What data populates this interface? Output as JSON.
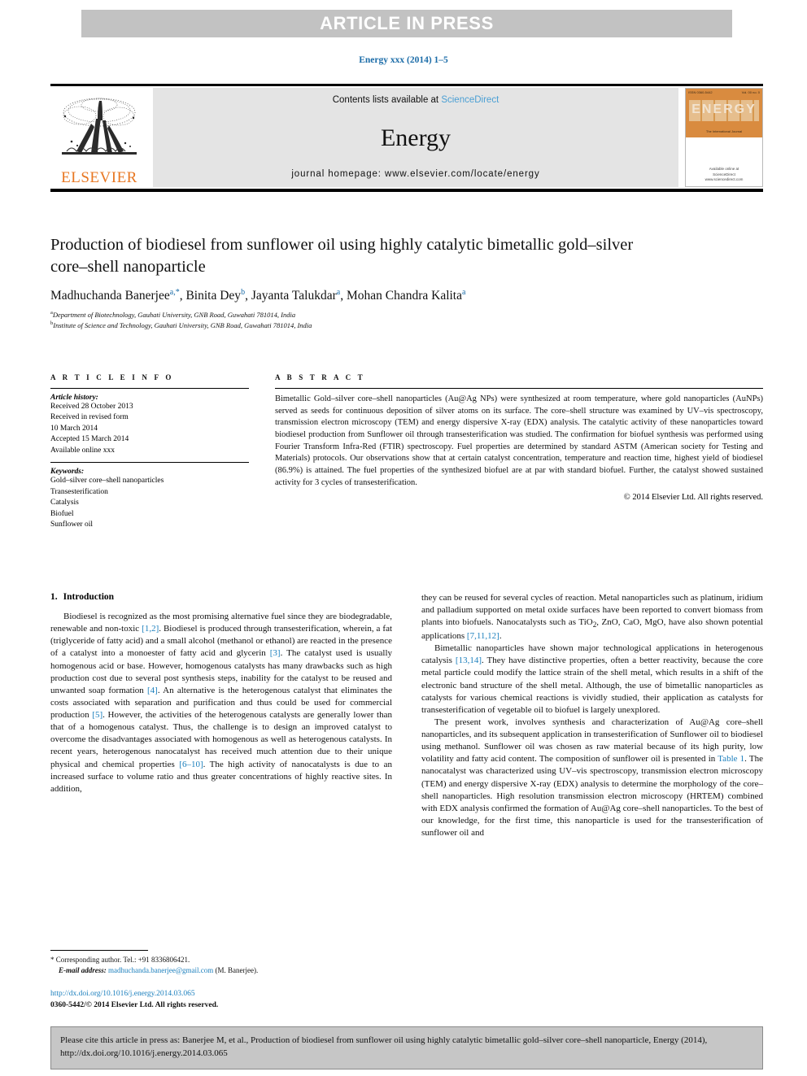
{
  "banner": {
    "label": "ARTICLE IN PRESS"
  },
  "running_head": "Energy xxx (2014) 1–5",
  "masthead": {
    "contents_prefix": "Contents lists available at ",
    "sciencedirect": "ScienceDirect",
    "journal_name": "Energy",
    "homepage": "journal homepage: www.elsevier.com/locate/energy",
    "publisher": "ELSEVIER",
    "cover": {
      "header_left": "ISSN 0360-5442",
      "header_right": "Vol. 00 no. 0",
      "word": "ENERGY",
      "subtitle": "The International Journal",
      "footer": "Available online at\nScienceDirect\nwww.sciencedirect.com"
    }
  },
  "article": {
    "title": "Production of biodiesel from sunflower oil using highly catalytic bimetallic gold–silver core–shell nanoparticle",
    "authors": [
      {
        "name": "Madhuchanda Banerjee",
        "marks": "a,*"
      },
      {
        "name": "Binita Dey",
        "marks": "b"
      },
      {
        "name": "Jayanta Talukdar",
        "marks": "a"
      },
      {
        "name": "Mohan Chandra Kalita",
        "marks": "a"
      }
    ],
    "affiliations": [
      {
        "mark": "a",
        "text": "Department of Biotechnology, Gauhati University, GNB Road, Guwahati 781014, India"
      },
      {
        "mark": "b",
        "text": "Institute of Science and Technology, Gauhati University, GNB Road, Guwahati 781014, India"
      }
    ]
  },
  "article_info": {
    "heading": "A R T I C L E  I N F O",
    "history_label": "Article history:",
    "history": [
      "Received 28 October 2013",
      "Received in revised form",
      "10 March 2014",
      "Accepted 15 March 2014",
      "Available online xxx"
    ],
    "keywords_label": "Keywords:",
    "keywords": [
      "Gold–silver core–shell nanoparticles",
      "Transesterification",
      "Catalysis",
      "Biofuel",
      "Sunflower oil"
    ]
  },
  "abstract": {
    "heading": "A B S T R A C T",
    "text": "Bimetallic Gold–silver core–shell nanoparticles (Au@Ag NPs) were synthesized at room temperature, where gold nanoparticles (AuNPs) served as seeds for continuous deposition of silver atoms on its surface. The core–shell structure was examined by UV–vis spectroscopy, transmission electron microscopy (TEM) and energy dispersive X-ray (EDX) analysis. The catalytic activity of these nanoparticles toward biodiesel production from Sunflower oil through transesterification was studied. The confirmation for biofuel synthesis was performed using Fourier Transform Infra-Red (FTIR) spectroscopy. Fuel properties are determined by standard ASTM (American society for Testing and Materials) protocols. Our observations show that at certain catalyst concentration, temperature and reaction time, highest yield of biodiesel (86.9%) is attained. The fuel properties of the synthesized biofuel are at par with standard biofuel. Further, the catalyst showed sustained activity for 3 cycles of transesterification.",
    "copyright": "© 2014 Elsevier Ltd. All rights reserved."
  },
  "introduction": {
    "number": "1.",
    "title": "Introduction",
    "left_paragraphs": [
      "Biodiesel is recognized as the most promising alternative fuel since they are biodegradable, renewable and non-toxic [1,2]. Biodiesel is produced through transesterification, wherein, a fat (triglyceride of fatty acid) and a small alcohol (methanol or ethanol) are reacted in the presence of a catalyst into a monoester of fatty acid and glycerin [3]. The catalyst used is usually homogenous acid or base. However, homogenous catalysts has many drawbacks such as high production cost due to several post synthesis steps, inability for the catalyst to be reused and unwanted soap formation [4]. An alternative is the heterogenous catalyst that eliminates the costs associated with separation and purification and thus could be used for commercial production [5]. However, the activities of the heterogenous catalysts are generally lower than that of a homogenous catalyst. Thus, the challenge is to design an improved catalyst to overcome the disadvantages associated with homogenous as well as heterogenous catalysts. In recent years, heterogenous nanocatalyst has received much attention due to their unique physical and chemical properties [6–10]. The high activity of nanocatalysts is due to an increased surface to volume ratio and thus greater concentrations of highly reactive sites. In addition,"
    ],
    "right_paragraphs": [
      "they can be reused for several cycles of reaction. Metal nanoparticles such as platinum, iridium and palladium supported on metal oxide surfaces have been reported to convert biomass from plants into biofuels. Nanocatalysts such as TiO2, ZnO, CaO, MgO, have also shown potential applications [7,11,12].",
      "Bimetallic nanoparticles have shown major technological applications in heterogenous catalysis [13,14]. They have distinctive properties, often a better reactivity, because the core metal particle could modify the lattice strain of the shell metal, which results in a shift of the electronic band structure of the shell metal. Although, the use of bimetallic nanoparticles as catalysts for various chemical reactions is vividly studied, their application as catalysts for transesterification of vegetable oil to biofuel is largely unexplored.",
      "The present work, involves synthesis and characterization of Au@Ag core–shell nanoparticles, and its subsequent application in transesterification of Sunflower oil to biodiesel using methanol. Sunflower oil was chosen as raw material because of its high purity, low volatility and fatty acid content. The composition of sunflower oil is presented in Table 1. The nanocatalyst was characterized using UV–vis spectroscopy, transmission electron microscopy (TEM) and energy dispersive X-ray (EDX) analysis to determine the morphology of the core–shell nanoparticles. High resolution transmission electron microscopy (HRTEM) combined with EDX analysis confirmed the formation of Au@Ag core–shell nanoparticles. To the best of our knowledge, for the first time, this nanoparticle is used for the transesterification of sunflower oil and"
    ]
  },
  "footnote": {
    "corresponding": "* Corresponding author. Tel.: +91 8336806421.",
    "email_label": "E-mail address:",
    "email": "madhuchanda.banerjee@gmail.com",
    "email_suffix": " (M. Banerjee)."
  },
  "doi_block": {
    "doi": "http://dx.doi.org/10.1016/j.energy.2014.03.065",
    "issn": "0360-5442/© 2014 Elsevier Ltd. All rights reserved."
  },
  "cite_box": {
    "text": "Please cite this article in press as: Banerjee M, et al., Production of biodiesel from sunflower oil using highly catalytic bimetallic gold–silver core–shell nanoparticle, Energy (2014), http://dx.doi.org/10.1016/j.energy.2014.03.065"
  },
  "colors": {
    "link_blue": "#1b7fbd",
    "sd_blue": "#4a9fd4",
    "elsevier_orange": "#e87722",
    "banner_gray": "#c2c2c2",
    "band_gray": "#e4e4e4",
    "cite_gray": "#c6c6c6"
  }
}
